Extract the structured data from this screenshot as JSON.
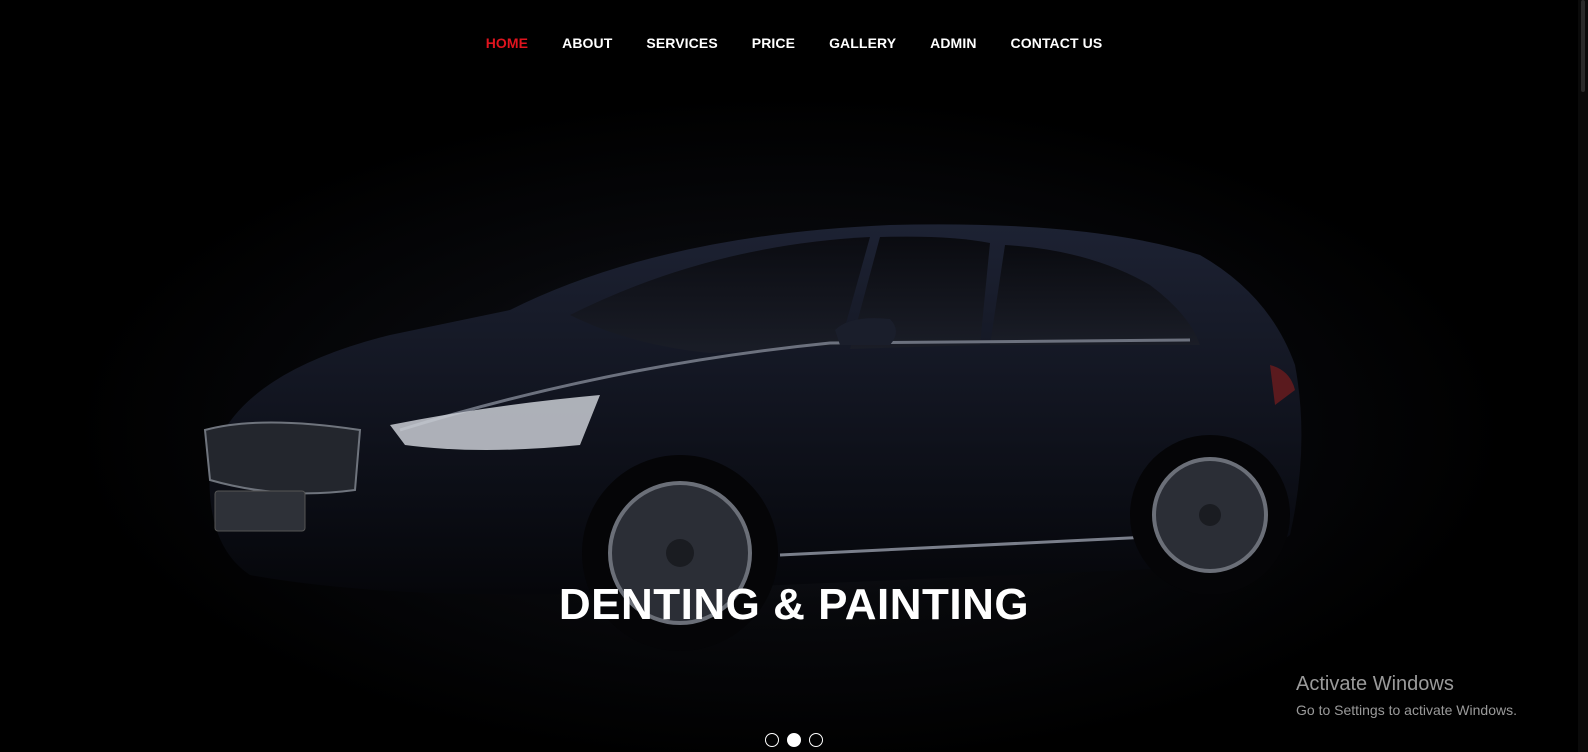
{
  "nav": {
    "items": [
      {
        "label": "HOME",
        "active": true
      },
      {
        "label": "ABOUT"
      },
      {
        "label": "SERVICES"
      },
      {
        "label": "PRICE"
      },
      {
        "label": "GALLERY"
      },
      {
        "label": "ADMIN"
      },
      {
        "label": "CONTACT US"
      }
    ],
    "active_color": "#e0141e"
  },
  "hero": {
    "caption": "DENTING & PAINTING",
    "carousel": {
      "slides": 3,
      "active_index": 1
    }
  },
  "watermark": {
    "title": "Activate Windows",
    "subtitle": "Go to Settings to activate Windows."
  }
}
